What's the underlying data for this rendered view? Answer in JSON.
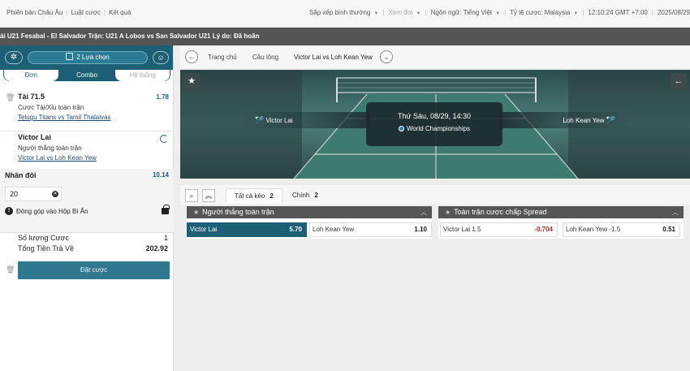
{
  "topbar": {
    "links": [
      "Phiên bản Châu Âu",
      "Luật cược",
      "Kết quả"
    ],
    "sort": "Sắp xếp bình thường",
    "view": "Xem đơi",
    "language_label": "Ngôn ngữ:",
    "language": "Tiếng Việt",
    "odds_label": "Tỷ lệ cược:",
    "odds_format": "Malaysia",
    "time": "12:10:24 GMT +7:00",
    "date": "2025/08/29"
  },
  "ticker": "ải U21 Fesabal - El Salvador Trận: U21 A Lobos vs San Salvador U21 Lý do: Đã hoãn",
  "betslip": {
    "selections": "2 Lựa chọn",
    "tabs": [
      "Đơn",
      "Combo",
      "Hệ thống"
    ],
    "active_tab": "Combo",
    "bets": [
      {
        "title": "Tài 71.5",
        "market": "Cược Tài/Xỉu toàn trận",
        "match": "Telugu Titans vs Tamil Thalaivas",
        "odds": "1.78"
      },
      {
        "title": "Victor Lai",
        "market": "Người thắng toàn trận",
        "match": "Victor Lai vs Loh Kean Yew",
        "odds": ""
      }
    ],
    "multi_title": "Nhân đôi",
    "multi_odds": "10.14",
    "stake": "20",
    "contribute": "Đóng góp vào Hộp Bí Ẩn",
    "bet_count_label": "Số lượng Cược",
    "bet_count": "1",
    "total_return_label": "Tổng Tiền Trả Về",
    "total_return": "202.92",
    "place_bet": "Đặt cược"
  },
  "nav": {
    "crumbs": [
      "Trang chủ",
      "Cầu lông",
      "Victor Lai vs Loh Kean Yew"
    ]
  },
  "banner": {
    "date": "Thứ Sáu, 08/29, 14:30",
    "competition": "World Championships",
    "home": "Victor Lai",
    "away": "Loh Kean Yew"
  },
  "filters": {
    "tabs": [
      {
        "label": "Tất cả kèo",
        "count": "2"
      },
      {
        "label": "Chính",
        "count": "2"
      }
    ]
  },
  "markets": [
    {
      "title": "Người thắng toàn trận",
      "selections": [
        {
          "name": "Victor Lai",
          "price": "5.70"
        },
        {
          "name": "Loh Kean Yew",
          "price": "1.10"
        }
      ]
    },
    {
      "title": "Toàn trận cược chấp Spread",
      "selections": [
        {
          "name": "Victor Lai 1.5",
          "price": "-0.704"
        },
        {
          "name": "Loh Kean Yew -1.5",
          "price": "0.51"
        }
      ]
    }
  ],
  "colors": {
    "brand": "#1d6076",
    "negative": "#cc2222"
  }
}
